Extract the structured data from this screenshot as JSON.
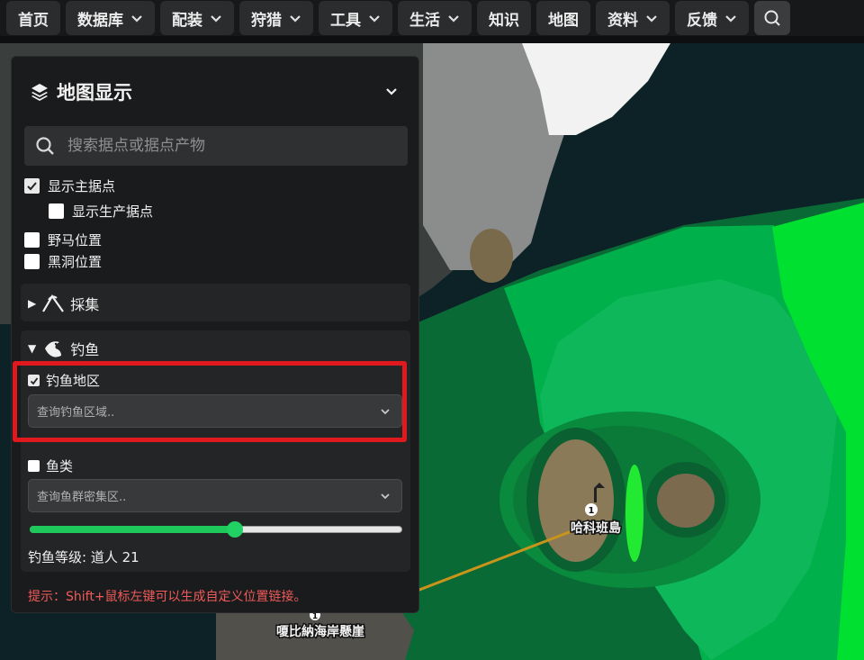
{
  "nav": {
    "items": [
      {
        "label": "首页",
        "dropdown": false
      },
      {
        "label": "数据库",
        "dropdown": true
      },
      {
        "label": "配装",
        "dropdown": true
      },
      {
        "label": "狩猎",
        "dropdown": true
      },
      {
        "label": "工具",
        "dropdown": true
      },
      {
        "label": "生活",
        "dropdown": true
      },
      {
        "label": "知识",
        "dropdown": false
      },
      {
        "label": "地图",
        "dropdown": false
      },
      {
        "label": "资料",
        "dropdown": true
      },
      {
        "label": "反馈",
        "dropdown": true
      }
    ],
    "search_icon": "search-icon"
  },
  "panel": {
    "title": "地图显示",
    "title_icon": "layers-icon",
    "search_placeholder": "搜索据点或据点产物",
    "checkboxes": {
      "main_nodes": {
        "label": "显示主据点",
        "checked": true
      },
      "production_nodes": {
        "label": "显示生产据点",
        "checked": false
      },
      "wild_horse": {
        "label": "野马位置",
        "checked": false
      },
      "black_hole": {
        "label": "黑洞位置",
        "checked": false
      }
    },
    "gathering": {
      "label": "採集",
      "expanded": false,
      "icon": "pickaxe-icon"
    },
    "fishing": {
      "label": "钓鱼",
      "expanded": true,
      "icon": "fish-icon",
      "area": {
        "label": "钓鱼地区",
        "checked": true,
        "dropdown_placeholder": "查询钓鱼区域.."
      },
      "fish": {
        "label": "鱼类",
        "checked": false,
        "dropdown_placeholder": "查询鱼群密集区.."
      },
      "level_fraction": 0.55,
      "level_text": "钓鱼等级: 道人 21"
    },
    "hint": "提示：Shift+鼠标左键可以生成自定义位置链接。"
  },
  "map": {
    "labels": {
      "island_1": "哈科班島",
      "island_1_marker": "1",
      "cliff": "嗄比納海岸懸崖",
      "cliff_marker": "1"
    },
    "colors": {
      "zone_bright": "#00e030",
      "zone_mid": "#00b04a",
      "zone_dark": "#0b8a3e",
      "zone_darker": "#0a6a35",
      "sea": "#0c2226",
      "highlight": "#e0191f"
    }
  }
}
